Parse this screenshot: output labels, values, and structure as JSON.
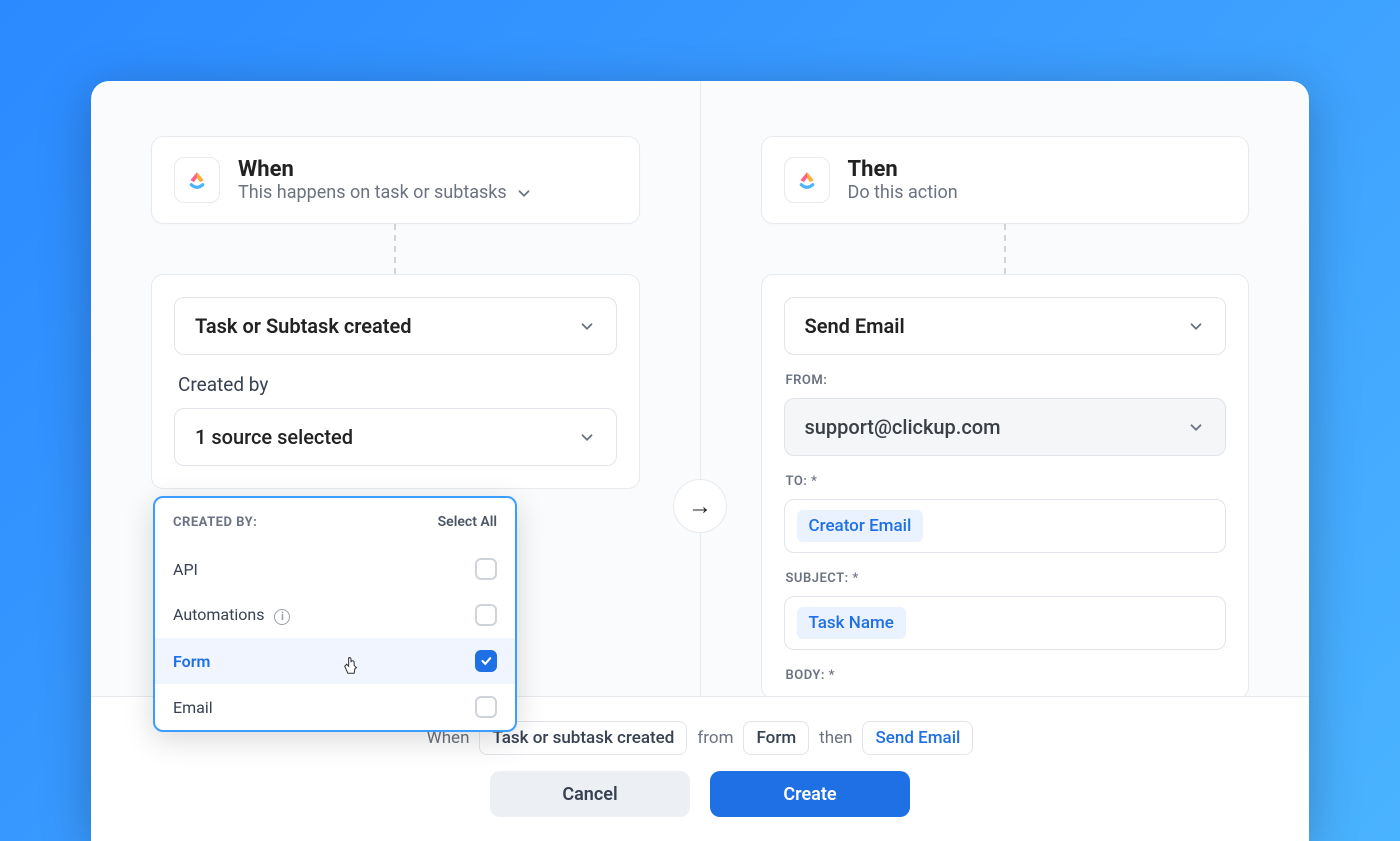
{
  "when": {
    "title": "When",
    "subtitle": "This happens on task or subtasks",
    "trigger_select": "Task or Subtask created",
    "created_by_label": "Created by",
    "source_select": "1 source selected"
  },
  "dropdown": {
    "header": "CREATED BY:",
    "select_all": "Select All",
    "items": [
      {
        "label": "API",
        "checked": false
      },
      {
        "label": "Automations",
        "checked": false,
        "info": true
      },
      {
        "label": "Form",
        "checked": true
      },
      {
        "label": "Email",
        "checked": false
      }
    ]
  },
  "then": {
    "title": "Then",
    "subtitle": "Do this action",
    "action_select": "Send Email",
    "from_label": "FROM:",
    "from_value": "support@clickup.com",
    "to_label": "TO: *",
    "to_chip": "Creator Email",
    "subject_label": "SUBJECT: *",
    "subject_chip": "Task Name",
    "body_label": "BODY: *"
  },
  "footer": {
    "when": "When",
    "trigger": "Task or subtask created",
    "from": "from",
    "source": "Form",
    "then": "then",
    "action": "Send Email",
    "cancel": "Cancel",
    "create": "Create"
  }
}
